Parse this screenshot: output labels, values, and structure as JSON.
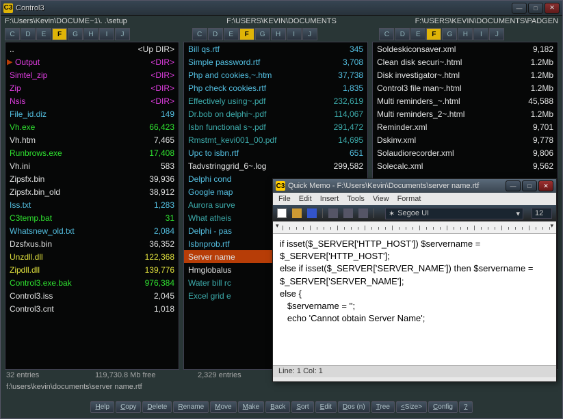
{
  "app": {
    "title": "Control3",
    "icon_text": "C3"
  },
  "paths": {
    "p1": "F:\\Users\\Kevin\\DOCUME~1\\. .\\setup",
    "p2": "F:\\USERS\\KEVIN\\DOCUMENTS",
    "p3": "F:\\USERS\\KEVIN\\DOCUMENTS\\PADGEN"
  },
  "drives": [
    "C",
    "D",
    "E",
    "F",
    "G",
    "H",
    "I",
    "J"
  ],
  "drive_active": "F",
  "panel1": [
    {
      "name": "..",
      "size": "<Up DIR>",
      "cls": "c-white"
    },
    {
      "name": "Output",
      "size": "<DIR>",
      "cls": "c-magenta",
      "cur": true
    },
    {
      "name": "Simtel_zip",
      "size": "<DIR>",
      "cls": "c-magenta"
    },
    {
      "name": "Zip",
      "size": "<DIR>",
      "cls": "c-magenta"
    },
    {
      "name": "Nsis",
      "size": "<DIR>",
      "cls": "c-magenta"
    },
    {
      "name": "File_id.diz",
      "size": "149",
      "cls": "c-cyan"
    },
    {
      "name": "Vh.exe",
      "size": "66,423",
      "cls": "c-green"
    },
    {
      "name": "Vh.htm",
      "size": "7,465",
      "cls": "c-white"
    },
    {
      "name": "Runbrows.exe",
      "size": "17,408",
      "cls": "c-green"
    },
    {
      "name": "Vh.ini",
      "size": "583",
      "cls": "c-white"
    },
    {
      "name": "Zipsfx.bin",
      "size": "39,936",
      "cls": "c-white"
    },
    {
      "name": "Zipsfx.bin_old",
      "size": "38,912",
      "cls": "c-white"
    },
    {
      "name": "Iss.txt",
      "size": "1,283",
      "cls": "c-cyan"
    },
    {
      "name": "C3temp.bat",
      "size": "31",
      "cls": "c-green"
    },
    {
      "name": "Whatsnew_old.txt",
      "size": "2,084",
      "cls": "c-cyan"
    },
    {
      "name": "Dzsfxus.bin",
      "size": "36,352",
      "cls": "c-white"
    },
    {
      "name": "Unzdll.dll",
      "size": "122,368",
      "cls": "c-yellow"
    },
    {
      "name": "Zipdll.dll",
      "size": "139,776",
      "cls": "c-yellow"
    },
    {
      "name": "Control3.exe.bak",
      "size": "976,384",
      "cls": "c-green"
    },
    {
      "name": "Control3.iss",
      "size": "2,045",
      "cls": "c-white"
    },
    {
      "name": "Control3.cnt",
      "size": "1,018",
      "cls": "c-white"
    }
  ],
  "panel2": [
    {
      "name": "Bill qs.rtf",
      "size": "345",
      "cls": "c-cyan"
    },
    {
      "name": "Simple password.rtf",
      "size": "3,708",
      "cls": "c-cyan"
    },
    {
      "name": "Php and cookies,~.htm",
      "size": "37,738",
      "cls": "c-cyan"
    },
    {
      "name": "Php check cookies.rtf",
      "size": "1,835",
      "cls": "c-cyan"
    },
    {
      "name": "Effectively using~.pdf",
      "size": "232,619",
      "cls": "c-teal"
    },
    {
      "name": "Dr.bob on delphi~.pdf",
      "size": "114,067",
      "cls": "c-teal"
    },
    {
      "name": "Isbn functional s~.pdf",
      "size": "291,472",
      "cls": "c-teal"
    },
    {
      "name": "Rmstmt_kevi001_00.pdf",
      "size": "14,695",
      "cls": "c-teal"
    },
    {
      "name": "Upc to isbn.rtf",
      "size": "651",
      "cls": "c-cyan"
    },
    {
      "name": "Tadvstringgrid_6~.log",
      "size": "299,582",
      "cls": "c-white"
    },
    {
      "name": "Delphi cond",
      "size": "",
      "cls": "c-cyan"
    },
    {
      "name": "Google map",
      "size": "",
      "cls": "c-cyan"
    },
    {
      "name": "Aurora surve",
      "size": "",
      "cls": "c-teal"
    },
    {
      "name": "What atheis",
      "size": "",
      "cls": "c-teal"
    },
    {
      "name": "Delphi - pas",
      "size": "",
      "cls": "c-cyan"
    },
    {
      "name": "Isbnprob.rtf",
      "size": "",
      "cls": "c-cyan"
    },
    {
      "name": "Server name",
      "size": "",
      "cls": "c-white",
      "hl": true
    },
    {
      "name": "Hmglobalus",
      "size": "",
      "cls": "c-white"
    },
    {
      "name": "Water bill rc",
      "size": "",
      "cls": "c-teal"
    },
    {
      "name": "Excel grid e",
      "size": "",
      "cls": "c-teal"
    }
  ],
  "panel3": [
    {
      "name": "Soldeskiconsaver.xml",
      "size": "9,182",
      "cls": "c-white"
    },
    {
      "name": "Clean disk securi~.html",
      "size": "1.2Mb",
      "cls": "c-white"
    },
    {
      "name": "Disk investigator~.html",
      "size": "1.2Mb",
      "cls": "c-white"
    },
    {
      "name": "Control3 file man~.html",
      "size": "1.2Mb",
      "cls": "c-white"
    },
    {
      "name": "Multi reminders_~.html",
      "size": "45,588",
      "cls": "c-white"
    },
    {
      "name": "Multi reminders_2~.html",
      "size": "1.2Mb",
      "cls": "c-white"
    },
    {
      "name": "Reminder.xml",
      "size": "9,701",
      "cls": "c-white"
    },
    {
      "name": "Dskinv.xml",
      "size": "9,778",
      "cls": "c-white"
    },
    {
      "name": "Solaudiorecorder.xml",
      "size": "9,806",
      "cls": "c-white"
    },
    {
      "name": "Solecalc.xml",
      "size": "9,562",
      "cls": "c-white"
    }
  ],
  "status": {
    "entries1": "32 entries",
    "free": "119,730.8 Mb free",
    "entries2": "2,329 entries"
  },
  "pathline": "f:\\users\\kevin\\documents\\server name.rtf",
  "buttons": [
    "Help",
    "Copy",
    "Delete",
    "Rename",
    "Move",
    "Make",
    "Back",
    "Sort",
    "Edit",
    "Dos (n)",
    "Tree",
    "<Size>",
    "Config",
    "?"
  ],
  "memo": {
    "title": "Quick Memo - F:\\Users\\Kevin\\Documents\\server name.rtf",
    "menu": [
      "File",
      "Edit",
      "Insert",
      "Tools",
      "View",
      "Format"
    ],
    "font": "Segoe UI",
    "fontsize": "12",
    "body": "if isset($_SERVER['HTTP_HOST']) $servername = $_SERVER['HTTP_HOST'];\nelse if isset($_SERVER['SERVER_NAME']) then $servername = $_SERVER['SERVER_NAME'];\nelse {\n   $servername = '';\n   echo 'Cannot obtain Server Name';",
    "status": "Line:  1 Col:  1"
  }
}
